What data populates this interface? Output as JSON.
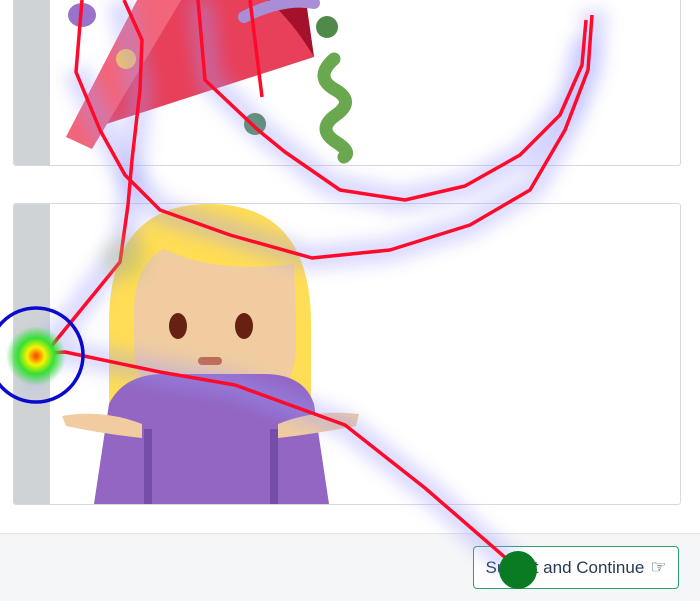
{
  "choices": [
    {
      "name": "party-popper"
    },
    {
      "name": "person-shrugging"
    }
  ],
  "footer": {
    "submit_label": "Submit and Continue",
    "submit_icon": "hand-pointing-right-icon"
  },
  "overlay": {
    "trail_color": "#ff0a2a",
    "fixation_color": "#0a0acc",
    "cursor_color": "#0a7a23"
  }
}
